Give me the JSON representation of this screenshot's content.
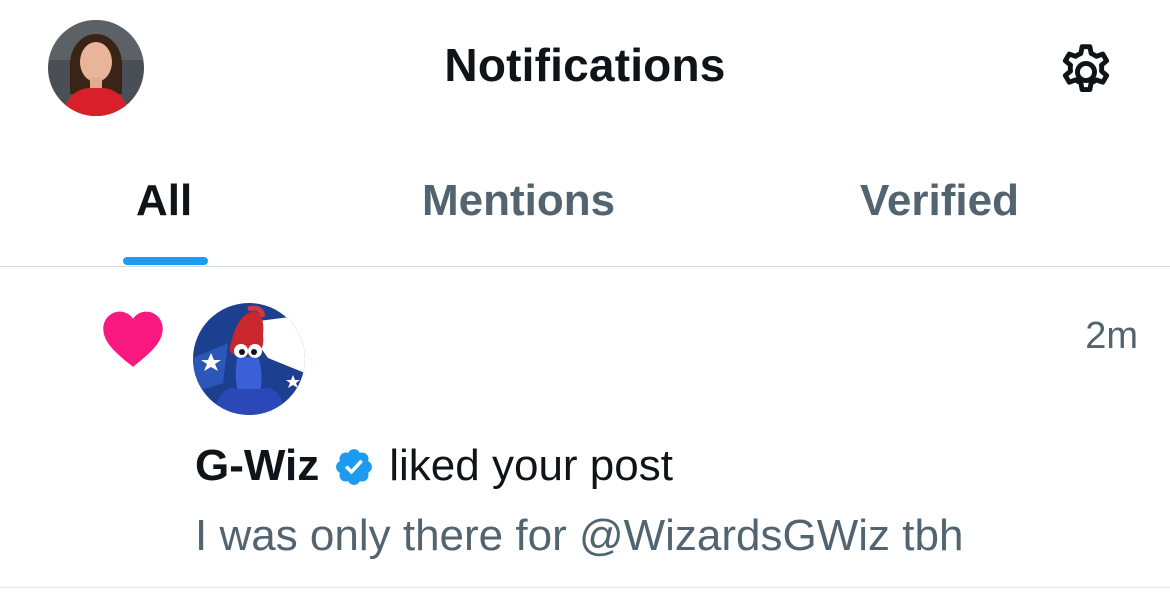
{
  "header": {
    "title": "Notifications",
    "avatar_icon": "user-avatar",
    "settings_icon": "gear-icon"
  },
  "tabs": [
    {
      "label": "All",
      "active": true
    },
    {
      "label": "Mentions",
      "active": false
    },
    {
      "label": "Verified",
      "active": false
    }
  ],
  "notifications": [
    {
      "type_icon": "heart-icon",
      "actor_avatar_icon": "mascot-avatar",
      "actor": "G-Wiz",
      "verified": true,
      "action": "liked your post",
      "time": "2m",
      "post_text": "I was only there for @WizardsGWiz tbh"
    }
  ],
  "colors": {
    "accent": "#1d9bf0",
    "like": "#f91880",
    "primary_text": "#0f1419",
    "secondary_text": "#536471",
    "divider": "#cfd9de"
  }
}
